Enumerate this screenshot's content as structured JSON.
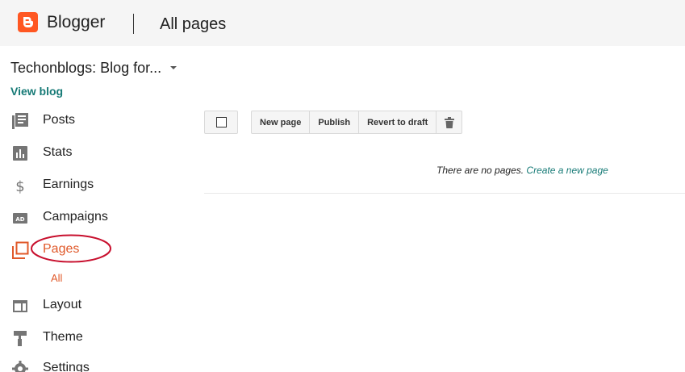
{
  "header": {
    "brand": "Blogger",
    "page_title": "All pages",
    "brand_color": "#ff5722"
  },
  "sidebar": {
    "blog_name": "Techonblogs: Blog for...",
    "view_blog": "View blog",
    "items": [
      {
        "label": "Posts",
        "icon": "posts-icon"
      },
      {
        "label": "Stats",
        "icon": "stats-icon"
      },
      {
        "label": "Earnings",
        "icon": "dollar-icon"
      },
      {
        "label": "Campaigns",
        "icon": "ad-icon"
      },
      {
        "label": "Pages",
        "icon": "pages-icon",
        "active": true
      },
      {
        "label": "Layout",
        "icon": "layout-icon"
      },
      {
        "label": "Theme",
        "icon": "paint-roller-icon"
      },
      {
        "label": "Settings",
        "icon": "gear-icon"
      }
    ],
    "pages_subitem": "All",
    "active_color": "#e0592a"
  },
  "toolbar": {
    "new_page": "New page",
    "publish": "Publish",
    "revert_to_draft": "Revert to draft",
    "delete_icon": "trash-icon"
  },
  "main": {
    "empty_text": "There are no pages.",
    "create_link": "Create a new page",
    "link_color": "#167a76"
  },
  "annotation": {
    "oval_color": "#c8102e"
  }
}
